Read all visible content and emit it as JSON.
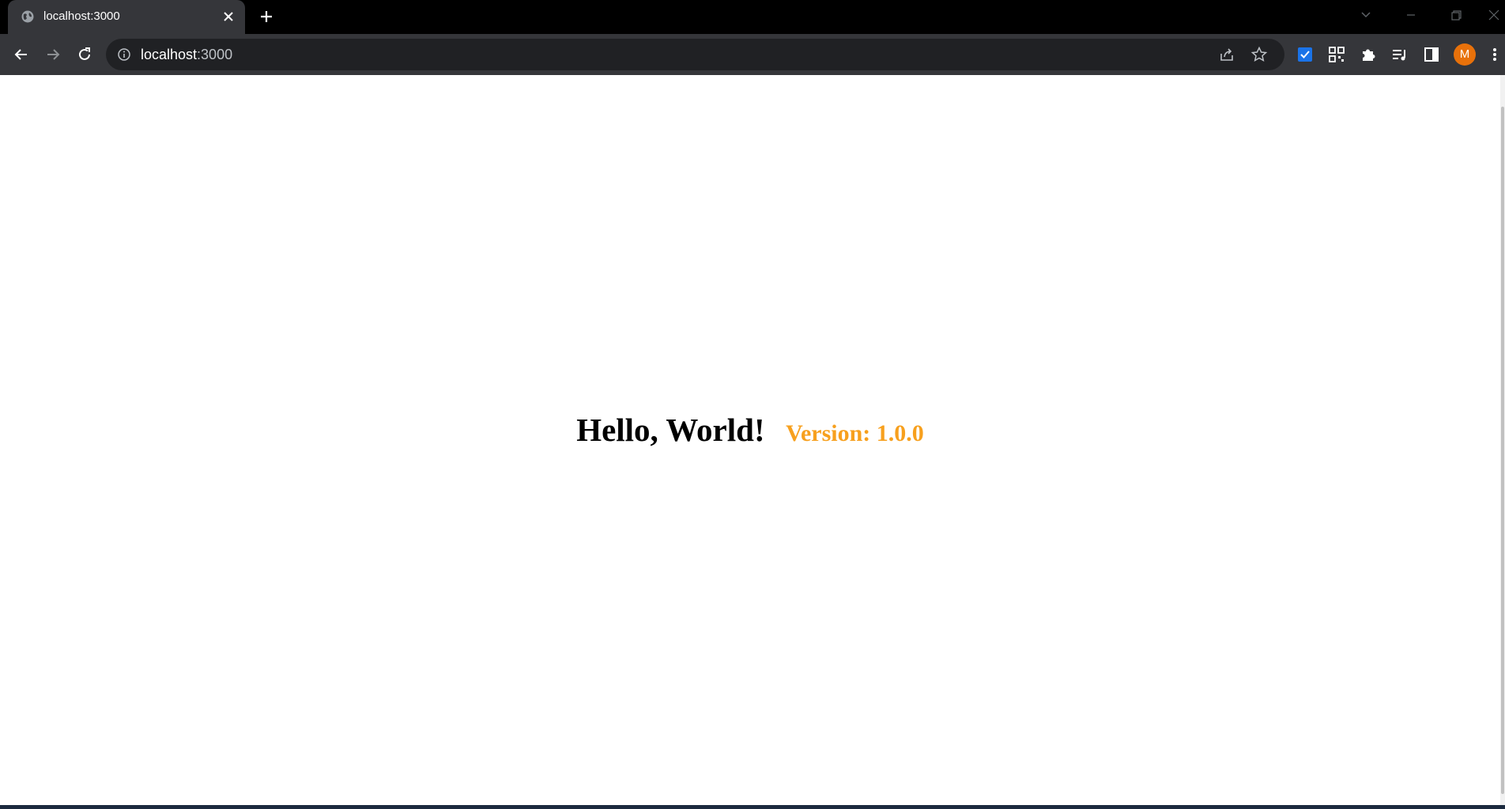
{
  "browser": {
    "tab": {
      "title": "localhost:3000",
      "favicon": "globe-icon"
    },
    "address_bar": {
      "host": "localhost",
      "port": ":3000"
    },
    "toolbar_icons": [
      "back-icon",
      "forward-icon",
      "reload-icon",
      "info-icon",
      "share-icon",
      "star-icon"
    ],
    "extensions": [
      "checkbox-extension-icon",
      "qr-code-icon",
      "puzzle-icon",
      "reading-list-icon",
      "side-panel-icon"
    ],
    "profile": {
      "initial": "M",
      "color": "#e8710a"
    }
  },
  "page": {
    "heading": "Hello, World!",
    "version_label": "Version: 1.0.0",
    "version_color": "#f7a01e"
  }
}
